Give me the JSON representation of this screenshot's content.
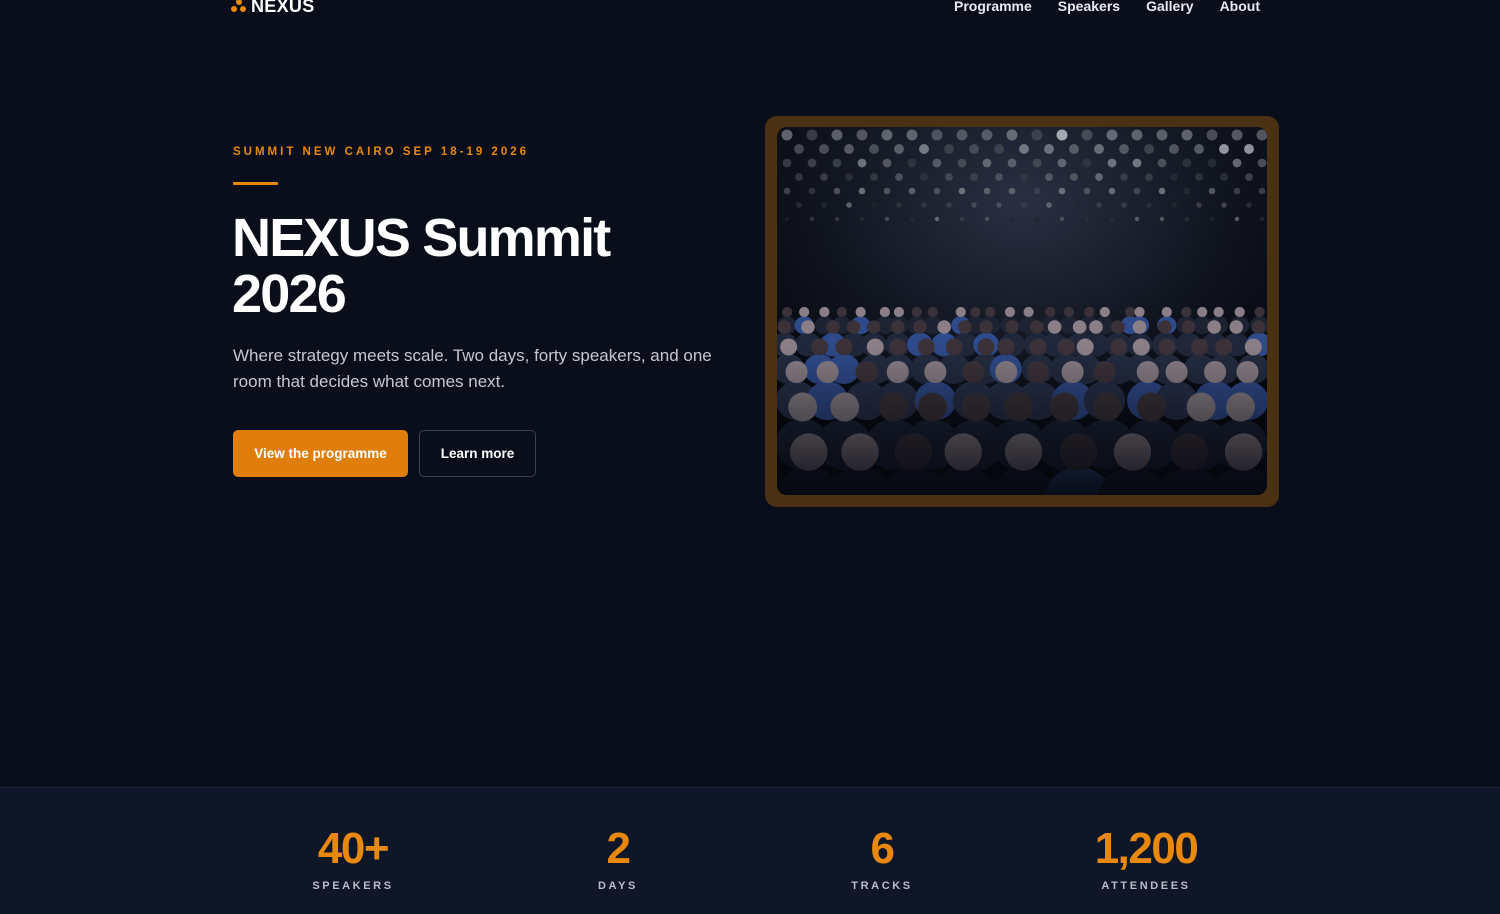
{
  "nav": {
    "logo_text": "NEXUS",
    "links": [
      {
        "label": "Programme"
      },
      {
        "label": "Speakers"
      },
      {
        "label": "Gallery"
      },
      {
        "label": "About"
      }
    ]
  },
  "hero": {
    "eyebrow": "SUMMIT NEW CAIRO SEP 18-19 2026",
    "title": "NEXUS Summit 2026",
    "subtitle": "Where strategy meets scale. Two days, forty speakers, and one room that decides what comes next.",
    "primary_button": "View the programme",
    "secondary_button": "Learn more"
  },
  "stats": [
    {
      "value": "40+",
      "label": "SPEAKERS"
    },
    {
      "value": "2",
      "label": "DAYS"
    },
    {
      "value": "6",
      "label": "TRACKS"
    },
    {
      "value": "1,200",
      "label": "ATTENDEES"
    }
  ],
  "colors": {
    "accent": "#e8890e",
    "background": "#0a0e1b",
    "stats_background": "#0f1628",
    "image_frame": "#4a3113"
  },
  "icons": {
    "logo": "tri-dot-logo-icon"
  }
}
